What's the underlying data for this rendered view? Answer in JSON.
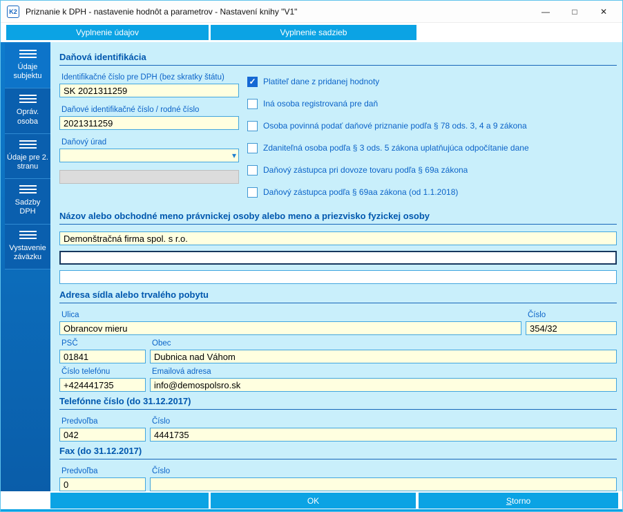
{
  "window": {
    "title": "Priznanie k DPH - nastavenie hodnôt a parametrov - Nastavení knihy \"V1\"",
    "icon_text": "K2",
    "minimize": "—",
    "maximize": "□",
    "close": "✕"
  },
  "icons": {
    "check": "✓",
    "dropdown": "▾"
  },
  "tabs": [
    {
      "label": "Vyplnenie údajov"
    },
    {
      "label": "Vyplnenie sadzieb"
    }
  ],
  "sidebar": [
    {
      "label": "Údaje subjektu"
    },
    {
      "label": "Opráv. osoba"
    },
    {
      "label": "Údaje pre 2. stranu"
    },
    {
      "label": "Sadzby DPH"
    },
    {
      "label": "Vystavenie záväzku"
    }
  ],
  "tax": {
    "title": "Daňová identifikácia",
    "vat_id": {
      "label": "Identifikačné číslo pre DPH (bez skratky štátu)",
      "value": "SK 2021311259"
    },
    "tin": {
      "label": "Daňové identifikačné číslo / rodné číslo",
      "value": "2021311259"
    },
    "office": {
      "label": "Daňový úrad",
      "value": ""
    },
    "office_name": {
      "value": ""
    },
    "checkboxes": [
      {
        "label": "Platiteľ dane z pridanej hodnoty",
        "checked": true
      },
      {
        "label": "Iná osoba registrovaná pre daň",
        "checked": false
      },
      {
        "label": "Osoba povinná podať daňové priznanie podľa § 78 ods. 3, 4 a 9 zákona",
        "checked": false
      },
      {
        "label": "Zdaniteľná osoba podľa § 3 ods. 5 zákona uplatňujúca odpočítanie dane",
        "checked": false
      },
      {
        "label": "Daňový zástupca pri dovoze tovaru podľa § 69a zákona",
        "checked": false
      },
      {
        "label": "Daňový zástupca podľa § 69aa zákona (od 1.1.2018)",
        "checked": false
      }
    ]
  },
  "name_section": {
    "title": "Názov alebo obchodné meno právnickej osoby alebo meno a priezvisko fyzickej osoby",
    "line1": "Demonštračná firma spol. s r.o.",
    "line2": "",
    "line3": ""
  },
  "address": {
    "title": "Adresa sídla alebo trvalého pobytu",
    "street": {
      "label": "Ulica",
      "value": "Obrancov mieru"
    },
    "number": {
      "label": "Číslo",
      "value": "354/32"
    },
    "zip": {
      "label": "PSČ",
      "value": "01841"
    },
    "city": {
      "label": "Obec",
      "value": "Dubnica nad Váhom"
    },
    "phone": {
      "label": "Číslo telefónu",
      "value": "+424441735"
    },
    "email": {
      "label": "Emailová adresa",
      "value": "info@demospolsro.sk"
    }
  },
  "phone2017": {
    "title": "Telefónne číslo (do 31.12.2017)",
    "prefix": {
      "label": "Predvoľba",
      "value": "042"
    },
    "number": {
      "label": "Číslo",
      "value": "4441735"
    }
  },
  "fax2017": {
    "title": "Fax (do 31.12.2017)",
    "prefix": {
      "label": "Predvoľba",
      "value": "0"
    },
    "number": {
      "label": "Číslo",
      "value": ""
    }
  },
  "footer": {
    "ok": "OK",
    "storno_accel": "S",
    "storno_rest": "torno"
  },
  "colors": {
    "accent": "#0ba3e4",
    "sidebar": "#0a5fae",
    "content_bg": "#c9effb",
    "input_bg": "#ffffe0",
    "heading": "#0057ae",
    "checkbox_checked": "#1568d4"
  }
}
